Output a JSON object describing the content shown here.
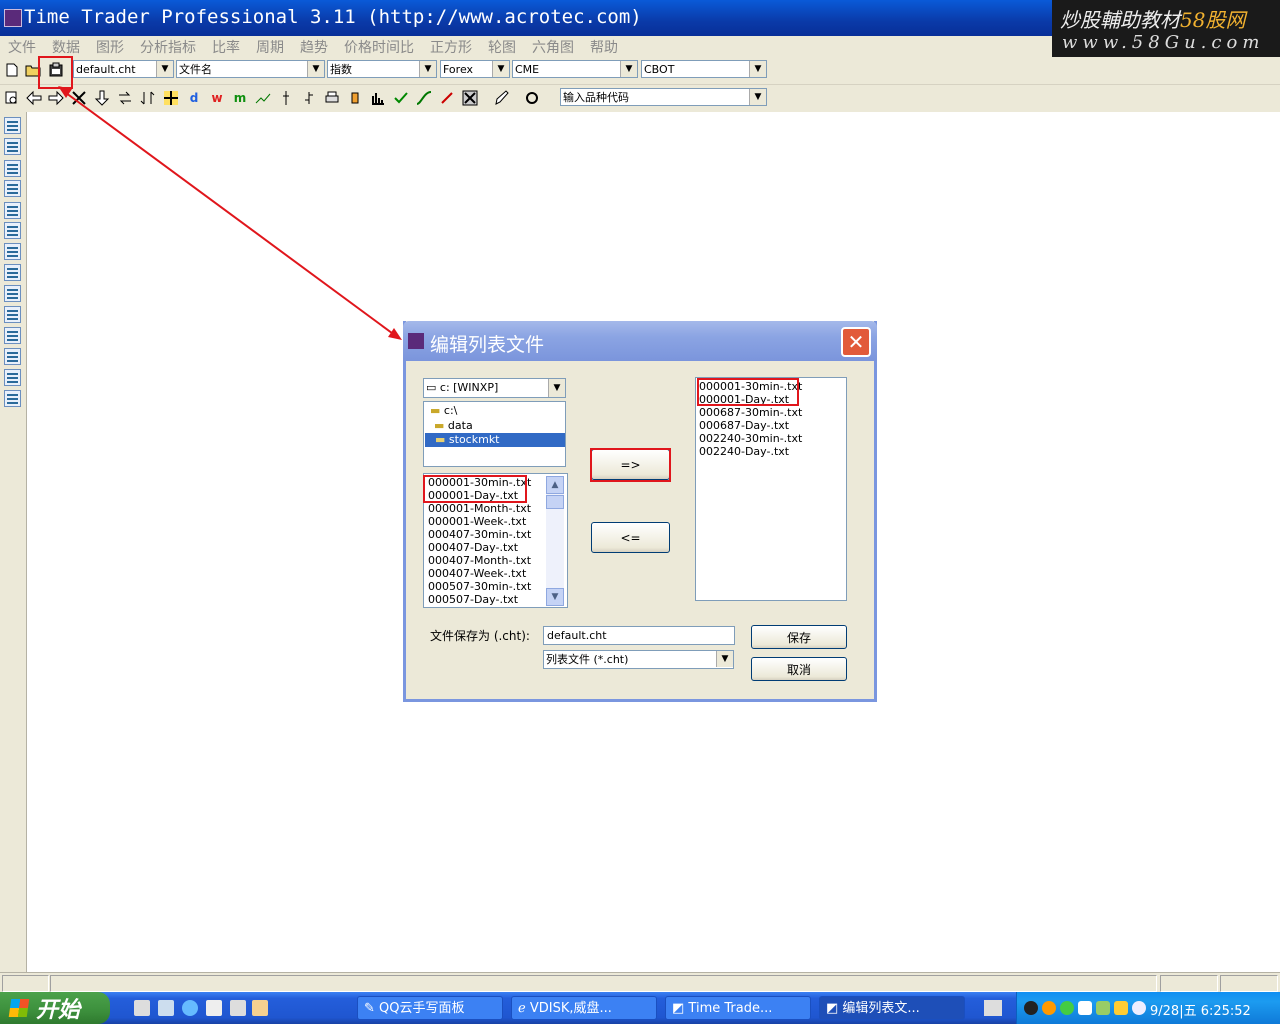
{
  "app": {
    "title": "Time Trader Professional 3.11 (http://www.acrotec.com)",
    "menu": [
      "文件",
      "数据",
      "图形",
      "分析指标",
      "比率",
      "周期",
      "趋势",
      "价格时间比",
      "正方形",
      "轮图",
      "六角图",
      "帮助"
    ]
  },
  "watermark": {
    "line1a": "炒股輔助教材",
    "line1b": "58股网",
    "line2": "www.58Gu.com"
  },
  "toolbar1": {
    "combos": [
      "default.cht",
      "文件名",
      "指数",
      "Forex",
      "CME",
      "CBOT"
    ]
  },
  "toolbar2": {
    "letters": [
      "d",
      "w",
      "m"
    ],
    "symbol_combo": "输入品种代码"
  },
  "dialog": {
    "title": "编辑列表文件",
    "drive": "c: [WINXP]",
    "folders": [
      "c:\\",
      "data",
      "stockmkt"
    ],
    "source_files": [
      "000001-30min-.txt",
      "000001-Day-.txt",
      "000001-Month-.txt",
      "000001-Week-.txt",
      "000407-30min-.txt",
      "000407-Day-.txt",
      "000407-Month-.txt",
      "000407-Week-.txt",
      "000507-30min-.txt",
      "000507-Day-.txt"
    ],
    "list_files": [
      "000001-30min-.txt",
      "000001-Day-.txt",
      "000687-30min-.txt",
      "000687-Day-.txt",
      "002240-30min-.txt",
      "002240-Day-.txt"
    ],
    "add_button": "=>",
    "remove_button": "<=",
    "save_as_label": "文件保存为 (.cht):",
    "save_as_value": "default.cht",
    "file_type": "列表文件 (*.cht)",
    "save_button": "保存",
    "cancel_button": "取消"
  },
  "taskbar": {
    "start": "开始",
    "tasks": [
      "QQ云手写面板",
      "VDISK,威盘...",
      "Time Trade...",
      "编辑列表文..."
    ],
    "clock": "9/28|五 6:25:52"
  },
  "colors": {
    "highlight": "#e0161c",
    "selection": "#316ac5",
    "title_blue": "#0a5ad8"
  }
}
